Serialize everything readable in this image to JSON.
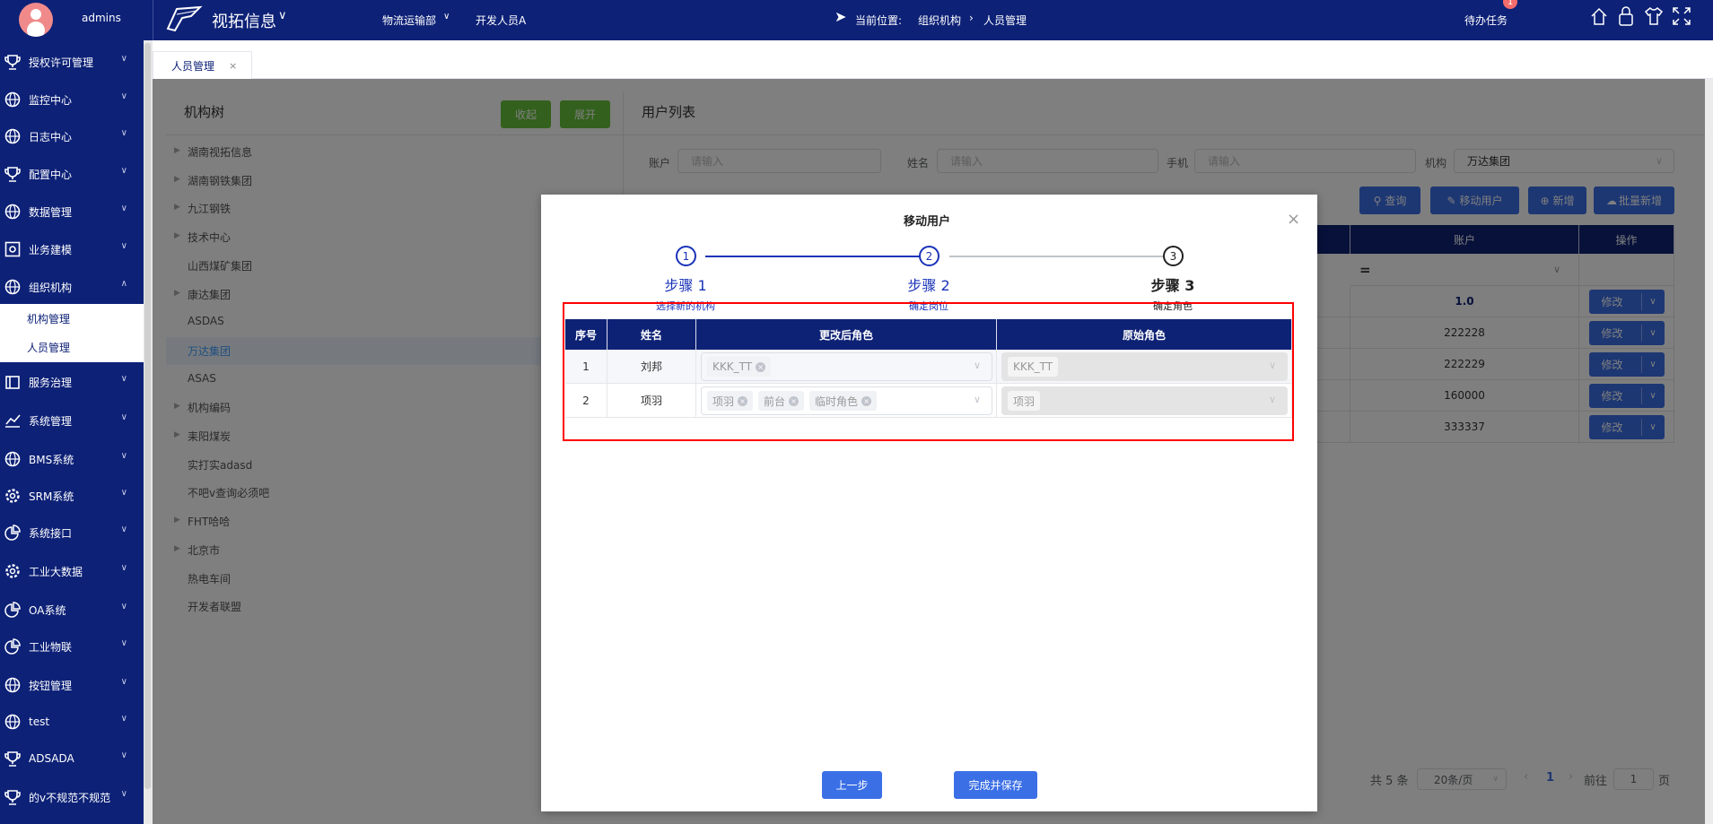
{
  "topbar": {
    "username": "admins",
    "brand": "视拓信息",
    "department": "物流运输部",
    "role": "开发人员A",
    "breadcrumb_label": "当前位置:",
    "breadcrumb": [
      "组织机构",
      "人员管理"
    ],
    "todo_label": "待办任务",
    "todo_badge": "1"
  },
  "sidebar": {
    "items": [
      {
        "label": "授权许可管理",
        "icon": "trophy"
      },
      {
        "label": "监控中心",
        "icon": "globe"
      },
      {
        "label": "日志中心",
        "icon": "globe"
      },
      {
        "label": "配置中心",
        "icon": "trophy"
      },
      {
        "label": "数据管理",
        "icon": "globe"
      },
      {
        "label": "业务建模",
        "icon": "gear-box"
      },
      {
        "label": "组织机构",
        "icon": "globe",
        "expanded": true
      },
      {
        "label": "服务治理",
        "icon": "box"
      },
      {
        "label": "系统管理",
        "icon": "chart"
      },
      {
        "label": "BMS系统",
        "icon": "globe"
      },
      {
        "label": "SRM系统",
        "icon": "gear"
      },
      {
        "label": "系统接口",
        "icon": "pie"
      },
      {
        "label": "工业大数据",
        "icon": "gear"
      },
      {
        "label": "OA系统",
        "icon": "pie"
      },
      {
        "label": "工业物联",
        "icon": "pie"
      },
      {
        "label": "按钮管理",
        "icon": "globe"
      },
      {
        "label": "test",
        "icon": "globe"
      },
      {
        "label": "ADSADA",
        "icon": "trophy"
      },
      {
        "label": "的v不规范不规范",
        "icon": "trophy"
      }
    ],
    "subitems": [
      "机构管理",
      "人员管理"
    ]
  },
  "tabs": [
    {
      "label": "人员管理"
    }
  ],
  "tree": {
    "title": "机构树",
    "collapse_label": "收起",
    "expand_label": "展开",
    "items": [
      {
        "label": "湖南视拓信息",
        "arrow": true
      },
      {
        "label": "湖南钢铁集团",
        "arrow": true
      },
      {
        "label": "九江钢铁",
        "arrow": true
      },
      {
        "label": "技术中心",
        "arrow": true
      },
      {
        "label": "山西煤矿集团",
        "arrow": false
      },
      {
        "label": "康达集团",
        "arrow": true
      },
      {
        "label": "ASDAS",
        "arrow": false
      },
      {
        "label": "万达集团",
        "arrow": false,
        "selected": true
      },
      {
        "label": "ASAS",
        "arrow": false
      },
      {
        "label": "机构编码",
        "arrow": true
      },
      {
        "label": "耒阳煤炭",
        "arrow": true
      },
      {
        "label": "实打实adasd",
        "arrow": false
      },
      {
        "label": "不吧v查询必须吧",
        "arrow": false
      },
      {
        "label": "FHT哈哈",
        "arrow": true
      },
      {
        "label": "北京市",
        "arrow": true
      },
      {
        "label": "热电车间",
        "arrow": false
      },
      {
        "label": "开发者联盟",
        "arrow": false
      }
    ]
  },
  "userlist": {
    "title": "用户列表",
    "filters": {
      "account_label": "账户",
      "account_placeholder": "请输入",
      "name_label": "姓名",
      "name_placeholder": "请输入",
      "phone_label": "手机",
      "phone_placeholder": "请输入",
      "org_label": "机构",
      "org_value": "万达集团"
    },
    "buttons": {
      "query": "查询",
      "move": "移动用户",
      "add": "新增",
      "batch_add": "批量新增"
    },
    "columns": [
      "账户",
      "操作"
    ],
    "filter_op": "=",
    "rows": [
      {
        "account": "1.0"
      },
      {
        "account": "222228"
      },
      {
        "account": "222229"
      },
      {
        "account": "160000"
      },
      {
        "account": "333337"
      }
    ],
    "edit_label": "修改",
    "pagination": {
      "total": "共 5 条",
      "page_size": "20条/页",
      "current": "1",
      "goto_label": "前往",
      "goto_value": "1",
      "page_suffix": "页"
    }
  },
  "dialog": {
    "title": "移动用户",
    "steps": [
      {
        "num": "1",
        "title": "步骤 1",
        "desc": "选择新的机构"
      },
      {
        "num": "2",
        "title": "步骤 2",
        "desc": "确定岗位"
      },
      {
        "num": "3",
        "title": "步骤 3",
        "desc": "确定角色"
      }
    ],
    "columns": [
      "序号",
      "姓名",
      "更改后角色",
      "原始角色"
    ],
    "rows": [
      {
        "index": "1",
        "name": "刘邦",
        "new_roles": [
          "KKK_TT"
        ],
        "old_roles": [
          "KKK_TT"
        ]
      },
      {
        "index": "2",
        "name": "项羽",
        "new_roles": [
          "项羽",
          "前台",
          "临时角色"
        ],
        "old_roles": [
          "项羽"
        ]
      }
    ],
    "prev_label": "上一步",
    "save_label": "完成并保存"
  },
  "colors": {
    "navy": "#0d2177",
    "primary": "#3b6fe6",
    "green": "#67c23a",
    "highlight_border": "#ff0000"
  }
}
